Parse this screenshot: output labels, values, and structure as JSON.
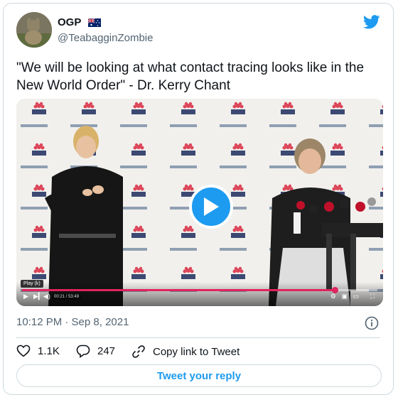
{
  "author": {
    "display_name": "OGP",
    "handle": "@TeabagginZombie",
    "flag_icon": "australia-flag-icon"
  },
  "tweet": {
    "text": "\"We will be looking at what contact tracing looks like in the New World Order\" - Dr. Kerry Chant",
    "timestamp": "10:12 PM · Sep 8, 2021"
  },
  "video": {
    "play_tooltip": "Play (k)",
    "time_readout": "00:21 / 53:49",
    "progress_fraction": 0.88,
    "backdrop_logo": "NSW",
    "backdrop_url": "nsw.gov.au"
  },
  "actions": {
    "likes": "1.1K",
    "replies": "247",
    "copy_link": "Copy link to Tweet",
    "reply_button": "Tweet your reply"
  },
  "colors": {
    "accent": "#1d9bf0",
    "like_red": "#e0245e",
    "secondary_text": "#536471"
  }
}
